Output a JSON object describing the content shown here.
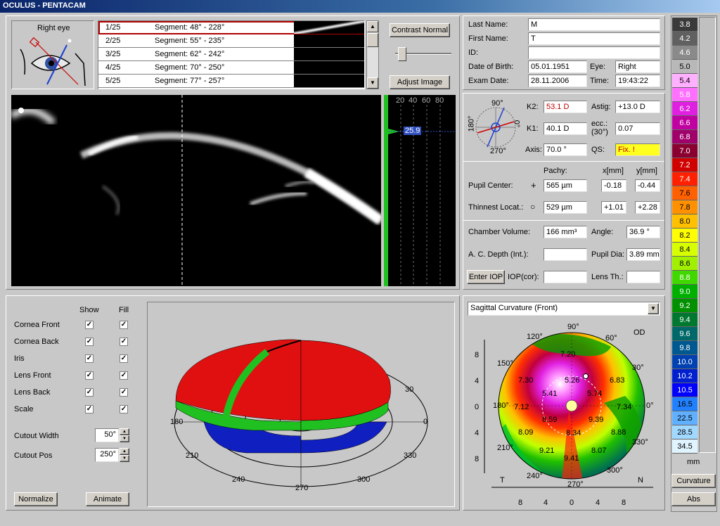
{
  "app": {
    "title": "OCULUS - PENTACAM"
  },
  "eye_panel": {
    "label": "Right eye"
  },
  "segments": [
    {
      "n": "1/25",
      "seg": "Segment: 48° - 228°"
    },
    {
      "n": "2/25",
      "seg": "Segment: 55° - 235°"
    },
    {
      "n": "3/25",
      "seg": "Segment: 62° - 242°"
    },
    {
      "n": "4/25",
      "seg": "Segment: 70° - 250°"
    },
    {
      "n": "5/25",
      "seg": "Segment: 77° - 257°"
    }
  ],
  "buttons": {
    "contrast": "Contrast Normal",
    "adjust": "Adjust Image",
    "normalize": "Normalize",
    "animate": "Animate",
    "enter_iop": "Enter IOP"
  },
  "densito": {
    "ticks": [
      "20",
      "40",
      "60",
      "80"
    ],
    "value": "25.9"
  },
  "patient": {
    "last_name_label": "Last Name:",
    "last_name": "M",
    "first_name_label": "First Name:",
    "first_name": "T",
    "id_label": "ID:",
    "id": "",
    "dob_label": "Date of Birth:",
    "dob": "05.01.1951",
    "eye_label": "Eye:",
    "eye": "Right",
    "exam_label": "Exam Date:",
    "exam": "28.11.2006",
    "time_label": "Time:",
    "time": "19:43:22"
  },
  "kvals": {
    "k2_label": "K2:",
    "k2": "53.1 D",
    "astig_label": "Astig:",
    "astig": "+13.0 D",
    "k1_label": "K1:",
    "k1": "40.1 D",
    "ecc_label": "ecc.: (30°)",
    "ecc_label_a": "ecc.:",
    "ecc_label_b": "(30°)",
    "ecc": "0.07",
    "axis_label": "Axis:",
    "axis": "70.0 °",
    "qs_label": "QS:",
    "qs": "Fix. !",
    "dial": {
      "top": "90°",
      "right": "0°",
      "bottom": "270°",
      "left": "180°"
    }
  },
  "pachy": {
    "pachy_label": "Pachy:",
    "x_label": "x[mm]",
    "y_label": "y[mm]",
    "pupil_label": "Pupil Center:",
    "pupil_pachy": "565 µm",
    "pupil_x": "-0.18",
    "pupil_y": "-0.44",
    "thin_label": "Thinnest Locat.:",
    "thin_pachy": "529 µm",
    "thin_x": "+1.01",
    "thin_y": "+2.28"
  },
  "chamber": {
    "vol_label": "Chamber Volume:",
    "vol": "166 mm³",
    "angle_label": "Angle:",
    "angle": "36.9 °",
    "acd_label": "A. C. Depth (Int.):",
    "acd": "",
    "pupil_dia_label": "Pupil Dia:",
    "pupil_dia": "3.89 mm",
    "iop_label": "IOP(cor):",
    "iop": "",
    "lens_label": "Lens Th.:",
    "lens": ""
  },
  "view3d": {
    "show_label": "Show",
    "fill_label": "Fill",
    "rows": [
      "Cornea Front",
      "Cornea Back",
      "Iris",
      "Lens Front",
      "Lens Back",
      "Scale"
    ],
    "cutout_width_label": "Cutout Width",
    "cutout_width": "50°",
    "cutout_pos_label": "Cutout Pos",
    "cutout_pos": "250°",
    "axis_labels": [
      "30",
      "0",
      "330",
      "300",
      "270",
      "240",
      "210",
      "180"
    ]
  },
  "map": {
    "select": "Sagittal Curvature (Front)",
    "od": "OD",
    "values": [
      "5.26",
      "6.83",
      "5.74",
      "7.30",
      "7.12",
      "8.09",
      "8.59",
      "7.34",
      "8.88",
      "9.21",
      "9.41",
      "8.07",
      "8.34",
      "9.39",
      "7.20",
      "5.41"
    ],
    "deg": [
      "90°",
      "60°",
      "30°",
      "0°",
      "330°",
      "300°",
      "270°",
      "240°",
      "210°",
      "180°",
      "150°",
      "120°"
    ],
    "nt": [
      "T",
      "N"
    ],
    "ticks": [
      "8",
      "4",
      "0",
      "4",
      "8"
    ]
  },
  "legend": {
    "values": [
      "3.8",
      "4.2",
      "4.6",
      "5.0",
      "5.4",
      "5.8",
      "6.2",
      "6.6",
      "6.8",
      "7.0",
      "7.2",
      "7.4",
      "7.6",
      "7.8",
      "8.0",
      "8.2",
      "8.4",
      "8.6",
      "8.8",
      "9.0",
      "9.2",
      "9.4",
      "9.6",
      "9.8",
      "10.0",
      "10.2",
      "10.5",
      "16.5",
      "22.5",
      "28.5",
      "34.5"
    ],
    "colors": [
      "#3a3a3a",
      "#606060",
      "#8a8a8a",
      "#b8b8b8",
      "#ffb0ff",
      "#ff70ff",
      "#e020e0",
      "#c000a0",
      "#a0006a",
      "#8a0030",
      "#d00000",
      "#ff2000",
      "#ff6000",
      "#ff9000",
      "#ffc000",
      "#ffff00",
      "#d8ff00",
      "#a0f000",
      "#40d800",
      "#00b000",
      "#009000",
      "#007830",
      "#006868",
      "#005890",
      "#0040b0",
      "#0020d0",
      "#0000ff",
      "#2080ff",
      "#60b0ff",
      "#a0d8ff",
      "#e0f4ff"
    ],
    "unit": "mm",
    "mode": "Curvature",
    "abs": "Abs"
  }
}
